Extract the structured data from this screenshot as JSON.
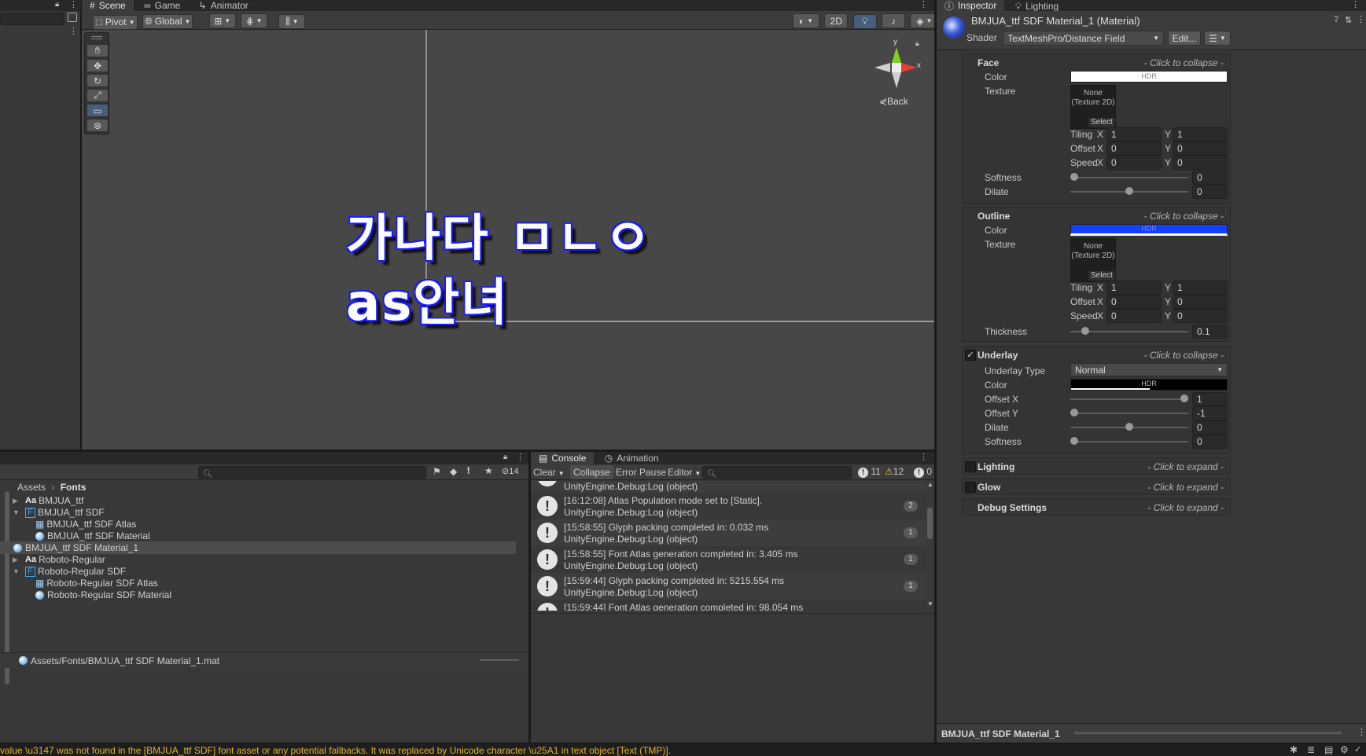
{
  "scene_tabs": {
    "scene": "Scene",
    "game": "Game",
    "animator": "Animator"
  },
  "scene_toolbar": {
    "pivot": "Pivot",
    "global": "Global",
    "mode_2d": "2D"
  },
  "gizmo": {
    "y": "y",
    "x": "x",
    "back": "Back"
  },
  "scene_text": {
    "line1": "가나다 ㅁㄴㅇ",
    "line2": "as안녀"
  },
  "inspector_tabs": {
    "inspector": "Inspector",
    "lighting": "Lighting"
  },
  "material": {
    "title": "BMJUA_ttf SDF Material_1 (Material)",
    "shader_label": "Shader",
    "shader_value": "TextMeshPro/Distance Field",
    "edit_button": "Edit...",
    "footer": "BMJUA_ttf SDF Material_1"
  },
  "common": {
    "click_to_collapse": "- Click to collapse -",
    "click_to_expand": "- Click to expand -",
    "hdr": "HDR",
    "texture_none": "None (Texture 2D)",
    "select": "Select",
    "tiling": "Tiling",
    "offset": "Offset",
    "speed": "Speed",
    "x": "X",
    "y": "Y",
    "color": "Color",
    "texture": "Texture"
  },
  "face": {
    "title": "Face",
    "tiling_x": "1",
    "tiling_y": "1",
    "offset_x": "0",
    "offset_y": "0",
    "speed_x": "0",
    "speed_y": "0",
    "softness_label": "Softness",
    "softness": "0",
    "dilate_label": "Dilate",
    "dilate": "0",
    "softness_level": 0.0,
    "dilate_level": 0.5,
    "color_hex": "#ffffff"
  },
  "outline": {
    "title": "Outline",
    "tiling_x": "1",
    "tiling_y": "1",
    "offset_x": "0",
    "offset_y": "0",
    "speed_x": "0",
    "speed_y": "0",
    "thickness_label": "Thickness",
    "thickness": "0.1",
    "thickness_level": 0.1,
    "color_hex": "#1140ff"
  },
  "underlay": {
    "title": "Underlay",
    "type_label": "Underlay Type",
    "type_value": "Normal",
    "color_label": "Color",
    "offset_x_label": "Offset X",
    "offset_x": "1",
    "offset_y_label": "Offset Y",
    "offset_y": "-1",
    "dilate_label": "Dilate",
    "dilate": "0",
    "softness_label": "Softness",
    "softness": "0",
    "offset_x_level": 1.0,
    "offset_y_level": 0.0,
    "dilate_level": 0.5,
    "softness_level": 0.0,
    "color_hex": "#000000"
  },
  "collapsed_sections": {
    "lighting": "Lighting",
    "glow": "Glow",
    "debug": "Debug Settings"
  },
  "project": {
    "breadcrumb_root": "Assets",
    "breadcrumb_current": "Fonts",
    "hidden_count": "14",
    "items": [
      {
        "label": "BMJUA_ttf",
        "icon": "Aa"
      },
      {
        "label": "BMJUA_ttf SDF",
        "icon": "F"
      },
      {
        "label": "BMJUA_ttf SDF Atlas",
        "icon": "grid"
      },
      {
        "label": "BMJUA_ttf SDF Material",
        "icon": "sphere"
      },
      {
        "label": "BMJUA_ttf SDF Material_1",
        "icon": "sphere"
      },
      {
        "label": "Roboto-Regular",
        "icon": "Aa"
      },
      {
        "label": "Roboto-Regular SDF",
        "icon": "F"
      },
      {
        "label": "Roboto-Regular SDF Atlas",
        "icon": "grid"
      },
      {
        "label": "Roboto-Regular SDF Material",
        "icon": "sphere"
      }
    ],
    "path": "Assets/Fonts/BMJUA_ttf SDF Material_1.mat"
  },
  "console": {
    "tabs": {
      "console": "Console",
      "animation": "Animation"
    },
    "toolbar": {
      "clear": "Clear",
      "collapse": "Collapse",
      "error_pause": "Error Pause",
      "editor": "Editor"
    },
    "counts": {
      "info": "11",
      "warning": "12",
      "error": "0"
    },
    "partial_top": "UnityEngine.Debug:Log (object)",
    "entries": [
      {
        "line1": "[16:12:08] Atlas Population mode set to [Static].",
        "line2": "UnityEngine.Debug:Log (object)",
        "count": "2"
      },
      {
        "line1": "[15:58:55] Glyph packing completed in: 0.032 ms",
        "line2": "UnityEngine.Debug:Log (object)",
        "count": "1"
      },
      {
        "line1": "[15:58:55] Font Atlas generation completed in: 3.405 ms",
        "line2": "UnityEngine.Debug:Log (object)",
        "count": "1"
      },
      {
        "line1": "[15:59:44] Glyph packing completed in: 5215.554 ms",
        "line2": "UnityEngine.Debug:Log (object)",
        "count": "1"
      }
    ],
    "partial_bottom": "[15:59:44] Font Atlas generation completed in: 98.054 ms"
  },
  "status_bar": "value \\u3147 was not found in the [BMJUA_ttf SDF] font asset or any potential fallbacks. It was replaced by Unicode character \\u25A1 in text object [Text (TMP)].",
  "colors": {
    "accent": "#46607c",
    "warning_text": "#e6b422",
    "outline_blue": "#1140ff"
  }
}
